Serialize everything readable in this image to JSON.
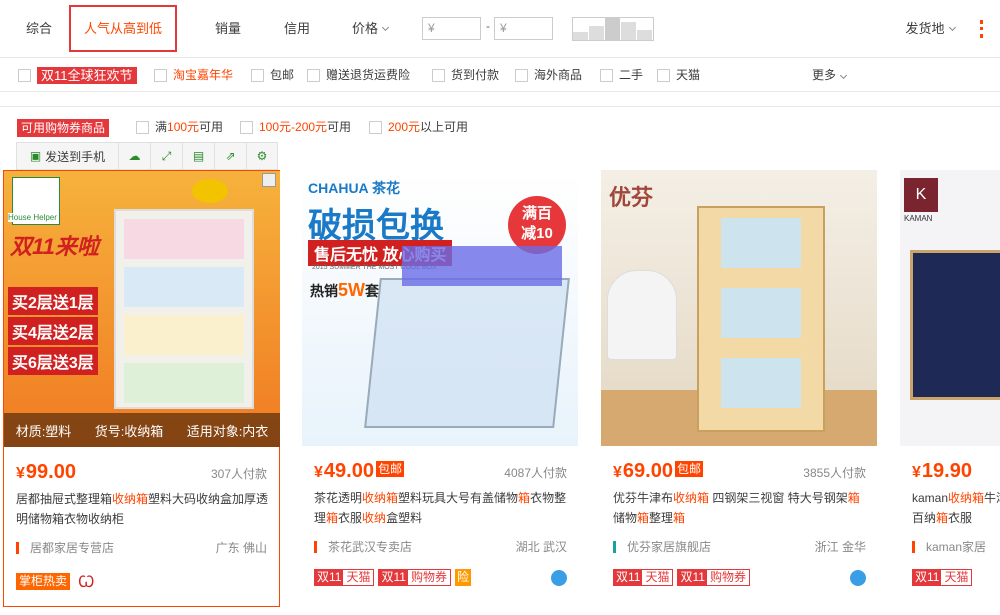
{
  "sort_tabs": {
    "comprehensive": "综合",
    "popularity": "人气从高到低",
    "sales": "销量",
    "credit": "信用",
    "price": "价格",
    "ship_from": "发货地"
  },
  "price_filter": {
    "min_placeholder": "¥",
    "max_placeholder": "¥",
    "dash": "-"
  },
  "filters": {
    "double11": "双11全球狂欢节",
    "carnival": "淘宝嘉年华",
    "free_shipping": "包邮",
    "return_insurance": "赠送退货运费险",
    "cod": "货到付款",
    "overseas": "海外商品",
    "second_hand": "二手",
    "tmall": "天猫",
    "more": "更多"
  },
  "coupons": {
    "tag": "可用购物券商品",
    "c1_prefix": "满",
    "c1_amount": "100元",
    "c1_suffix": "可用",
    "c2_range": "100元-200元",
    "c2_suffix": "可用",
    "c3_amount": "200元",
    "c3_suffix": "以上可用"
  },
  "toolbar": {
    "send_phone": "发送到手机"
  },
  "products": [
    {
      "price": "99.00",
      "currency": "¥",
      "sold": "307人付款",
      "title_parts": [
        "居都抽屉式整理箱",
        "收纳箱",
        "塑料大码收纳盒加厚透明储物箱衣物收纳柜"
      ],
      "shop": "居都家居专营店",
      "location": "广东 佛山",
      "badge": "掌柜热卖",
      "img_text": {
        "brand": "House Helper",
        "headline": "双11来啦",
        "p1": "买2层送1层",
        "p2": "买4层送2层",
        "p3": "买6层送3层",
        "o1": "材质:塑料",
        "o2": "货号:收纳箱",
        "o3": "适用对象:内衣"
      }
    },
    {
      "price": "49.00",
      "currency": "¥",
      "baoyou": "包邮",
      "sold": "4087人付款",
      "title_parts": [
        "茶花透明",
        "收纳箱",
        "塑料玩具大号有盖储物",
        "箱",
        "衣物整理",
        "箱",
        "衣服",
        "收纳",
        "盒塑料"
      ],
      "shop": "茶花武汉专卖店",
      "location": "湖北 武汉",
      "img_text": {
        "brand": "CHAHUA 茶花",
        "headline": "破损包换",
        "sub": "售后无忧 放心购买",
        "badge1": "满百",
        "badge2": "减10",
        "small": "2015 SUMMER THE MOST COOL BOX",
        "hot": "热销",
        "hot5w": "5W",
        "hotset": "套"
      }
    },
    {
      "price": "69.00",
      "currency": "¥",
      "baoyou": "包邮",
      "sold": "3855人付款",
      "title_parts": [
        "优芬牛津布",
        "收纳箱",
        " 四钢架三视窗 特大号钢架",
        "箱",
        " 储物",
        "箱",
        "整理",
        "箱"
      ],
      "shop": "优芬家居旗舰店",
      "location": "浙江 金华",
      "img_text": {
        "brand": "优芬"
      }
    },
    {
      "price": "19.90",
      "currency": "¥",
      "sold": "",
      "title_parts": [
        "kaman",
        "收纳箱",
        "牛津布",
        "百纳",
        "箱",
        "衣服"
      ],
      "shop": "kaman家居",
      "location": "",
      "img_text": {
        "brand": "KAMAN"
      }
    }
  ],
  "promo_icons": {
    "d11": "双11",
    "tmall": "天猫",
    "coupon": "购物券",
    "xian": "险"
  }
}
